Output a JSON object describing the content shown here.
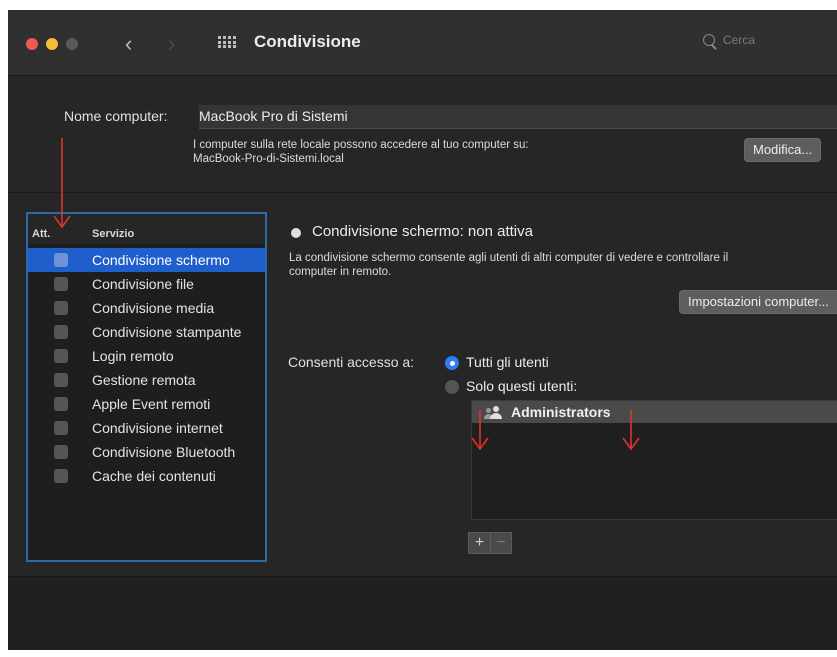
{
  "window": {
    "title": "Condivisione",
    "nav_back": "‹",
    "nav_forward": "›",
    "search_placeholder": "Cerca"
  },
  "computer": {
    "name_label": "Nome computer:",
    "name_value": "MacBook Pro di Sistemi",
    "desc_line1": "I computer sulla rete locale possono accedere al tuo computer su:",
    "desc_line2": "MacBook-Pro-di-Sistemi.local",
    "edit_button": "Modifica..."
  },
  "services": {
    "header_on": "Att.",
    "header_service": "Servizio",
    "items": [
      {
        "label": "Condivisione schermo",
        "selected": true,
        "checked": false
      },
      {
        "label": "Condivisione file",
        "selected": false,
        "checked": false
      },
      {
        "label": "Condivisione media",
        "selected": false,
        "checked": false
      },
      {
        "label": "Condivisione stampante",
        "selected": false,
        "checked": false
      },
      {
        "label": "Login remoto",
        "selected": false,
        "checked": false
      },
      {
        "label": "Gestione remota",
        "selected": false,
        "checked": false
      },
      {
        "label": "Apple Event remoti",
        "selected": false,
        "checked": false
      },
      {
        "label": "Condivisione internet",
        "selected": false,
        "checked": false
      },
      {
        "label": "Condivisione Bluetooth",
        "selected": false,
        "checked": false
      },
      {
        "label": "Cache dei contenuti",
        "selected": false,
        "checked": false
      }
    ]
  },
  "detail": {
    "status": "Condivisione schermo: non attiva",
    "desc_line1": "La condivisione schermo consente agli utenti di altri computer di vedere e controllare il",
    "desc_line2": "computer in remoto.",
    "settings_button": "Impostazioni computer...",
    "access_label": "Consenti accesso a:",
    "option_all": "Tutti gli utenti",
    "option_only": "Solo questi utenti:",
    "selected_option": "all",
    "users": [
      "Administrators"
    ],
    "add_button": "+",
    "remove_button": "−"
  },
  "colors": {
    "window_bg": "#262626",
    "selection": "#1f5fcc",
    "highlight_border": "#2d6ba6",
    "annotation_arrow": "#e0332b",
    "radio_on": "#2f7bf0"
  }
}
